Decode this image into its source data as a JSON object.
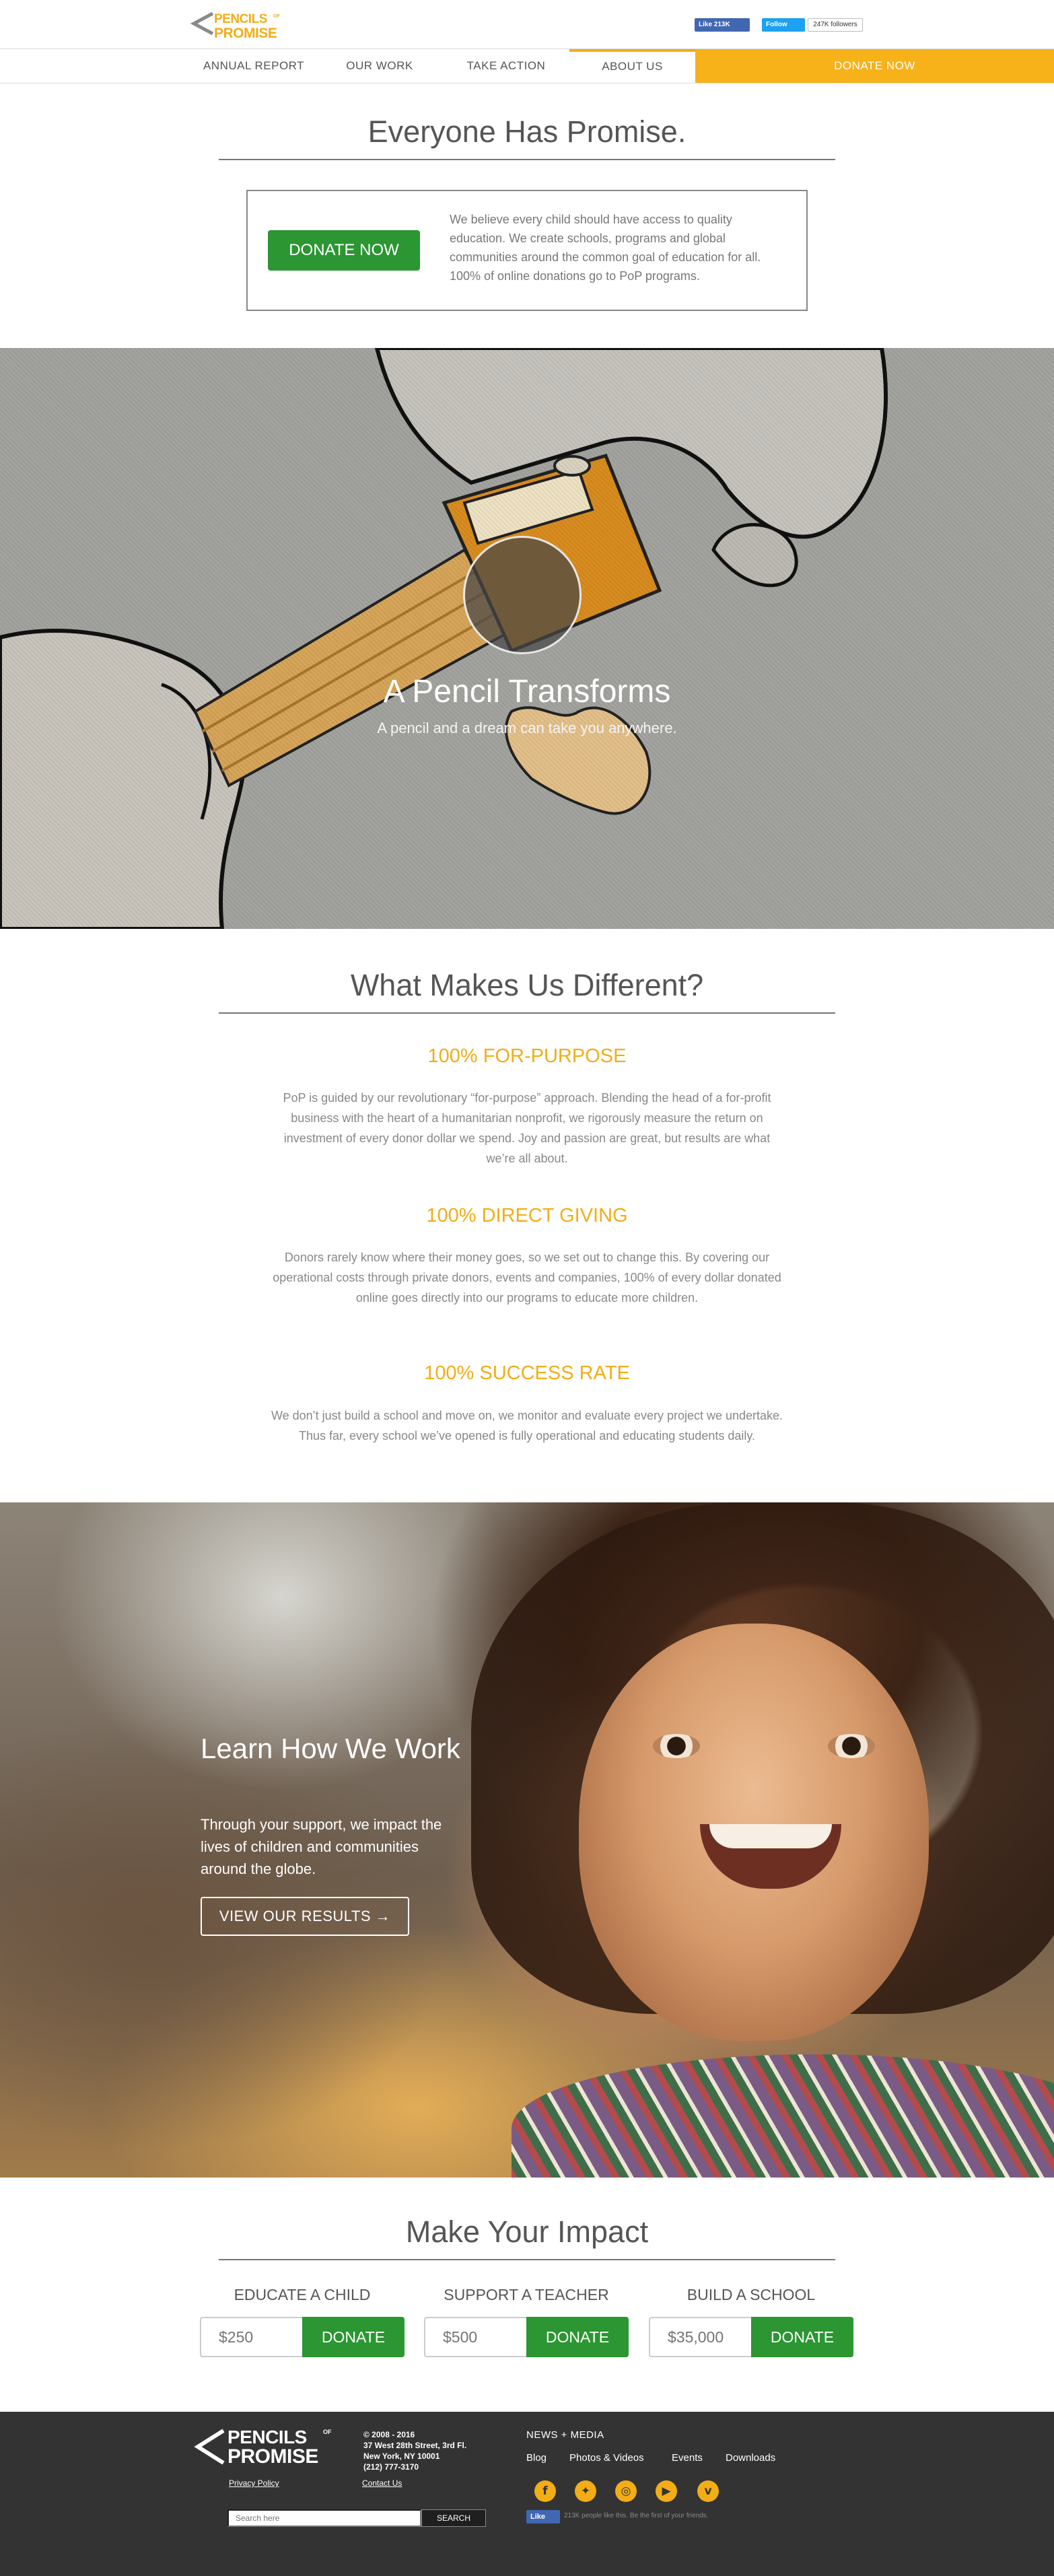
{
  "brand": {
    "logo_line1": "PENCILS",
    "logo_line2": "PROMISE",
    "logo_of": "OF",
    "accent": "#f2ad17",
    "green": "#2b9632",
    "footer_bg": "#333333"
  },
  "header": {
    "fb_like": "Like 213K",
    "tw_follow": "Follow",
    "tw_followers": "247K followers"
  },
  "nav": {
    "items": [
      {
        "label": "ANNUAL REPORT",
        "active": false
      },
      {
        "label": "OUR WORK",
        "active": false
      },
      {
        "label": "TAKE ACTION",
        "active": false
      },
      {
        "label": "ABOUT US",
        "active": true
      }
    ],
    "donate": "DONATE NOW"
  },
  "intro": {
    "title": "Everyone Has Promise.",
    "donate_button": "DONATE NOW",
    "text": "We believe every child should have access to quality education. We create schools, programs and global communities around the common goal of education for all. 100% of online donations go to PoP programs."
  },
  "video": {
    "title": "A Pencil Transforms",
    "subtitle": "A pencil and a dream can take you anywhere.",
    "play_icon": "play-icon"
  },
  "different": {
    "title": "What Makes Us Different?",
    "items": [
      {
        "heading": "100% FOR-PURPOSE",
        "text": "PoP is guided by our revolutionary “for-purpose” approach. Blending the head of a for-profit business with the heart of a humanitarian nonprofit, we rigorously measure the return on investment of every donor dollar we spend. Joy and passion are great, but results are what we’re all about."
      },
      {
        "heading": "100% DIRECT GIVING",
        "text": "Donors rarely know where their money goes, so we set out to change this. By covering our operational costs through private donors, events and companies, 100% of every dollar donated online goes directly into our programs to educate more children."
      },
      {
        "heading": "100% SUCCESS RATE",
        "text": "We don’t just build a school and move on, we monitor and evaluate every project we undertake. Thus far, every school we’ve opened is fully operational and educating students daily."
      }
    ]
  },
  "learn": {
    "title": "Learn How We Work",
    "text": "Through your support, we impact the lives of children and communities around the globe.",
    "button": "VIEW OUR RESULTS →"
  },
  "impact": {
    "title": "Make Your Impact",
    "options": [
      {
        "label": "EDUCATE A CHILD",
        "placeholder": "$250",
        "button": "DONATE"
      },
      {
        "label": "SUPPORT A TEACHER",
        "placeholder": "$500",
        "button": "DONATE"
      },
      {
        "label": "BUILD A SCHOOL",
        "placeholder": "$35,000",
        "button": "DONATE"
      }
    ]
  },
  "footer": {
    "privacy": "Privacy Policy",
    "contact": "Contact Us",
    "address": [
      "© 2008 - 2016",
      "37 West 28th Street, 3rd Fl.",
      "New York, NY 10001",
      "(212) 777-3170"
    ],
    "news_title": "NEWS + MEDIA",
    "news_links": [
      "Blog",
      "Photos & Videos",
      "Events",
      "Downloads"
    ],
    "social_icons": [
      "facebook-icon",
      "twitter-icon",
      "instagram-icon",
      "youtube-icon",
      "vimeo-icon"
    ],
    "search_placeholder": "Search here",
    "search_button": "SEARCH",
    "fb_like": "Like",
    "fb_text": "213K people like this. Be the first of your friends."
  }
}
